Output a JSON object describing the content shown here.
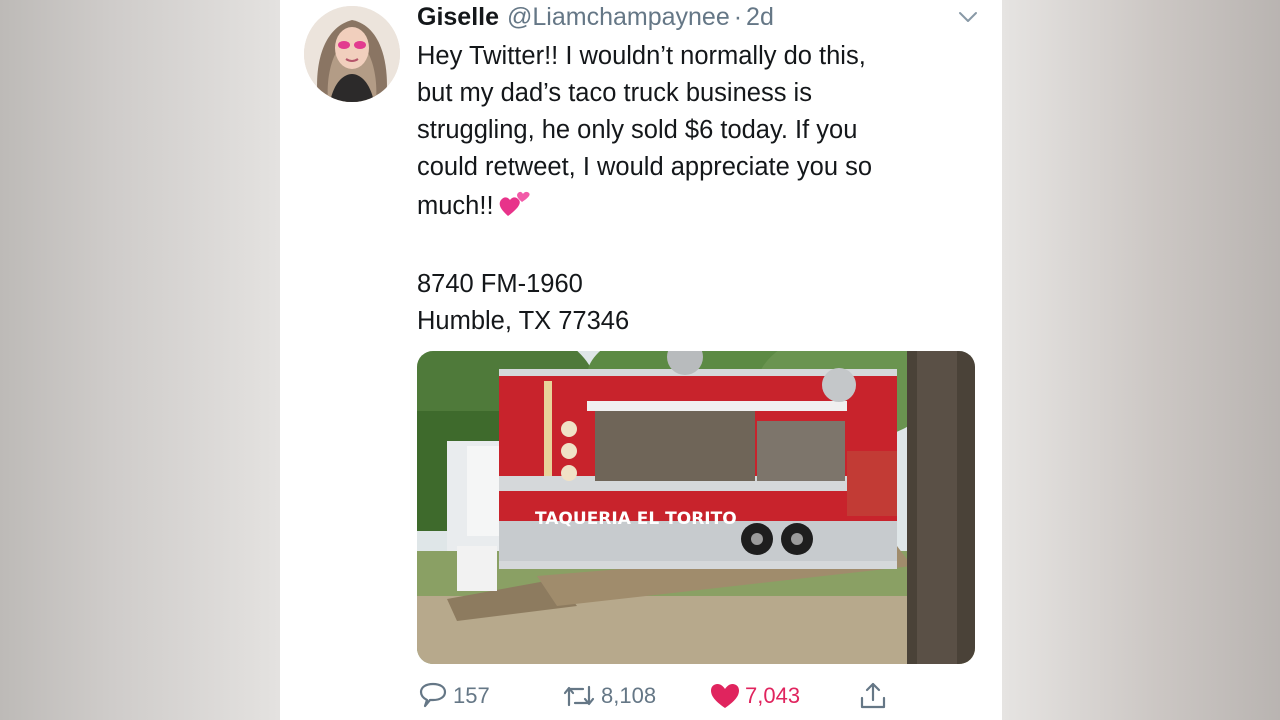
{
  "tweet": {
    "author_name": "Giselle",
    "handle": "@Liamchampaynee",
    "separator": "·",
    "time": "2d",
    "text_lines": [
      "Hey Twitter!! I wouldn’t normally do this,",
      "but my dad’s taco truck business is",
      "struggling, he only sold $6 today. If you",
      "could retweet, I would appreciate you so",
      "much!!"
    ],
    "address_line1": "8740 FM-1960",
    "address_line2": "Humble, TX  77346",
    "emoji_icon": "two-hearts-icon",
    "image": {
      "truck_sign": "TAQUERIA EL TORITO"
    }
  },
  "actions": {
    "reply_count": "157",
    "retweet_count": "8,108",
    "like_count": "7,043",
    "like_color": "#e0245e"
  },
  "icons": [
    "chevron-down-icon",
    "reply-icon",
    "retweet-icon",
    "heart-icon",
    "share-icon"
  ],
  "colors": {
    "text": "#14171a",
    "secondary": "#657786",
    "truck_red": "#c8232c"
  }
}
